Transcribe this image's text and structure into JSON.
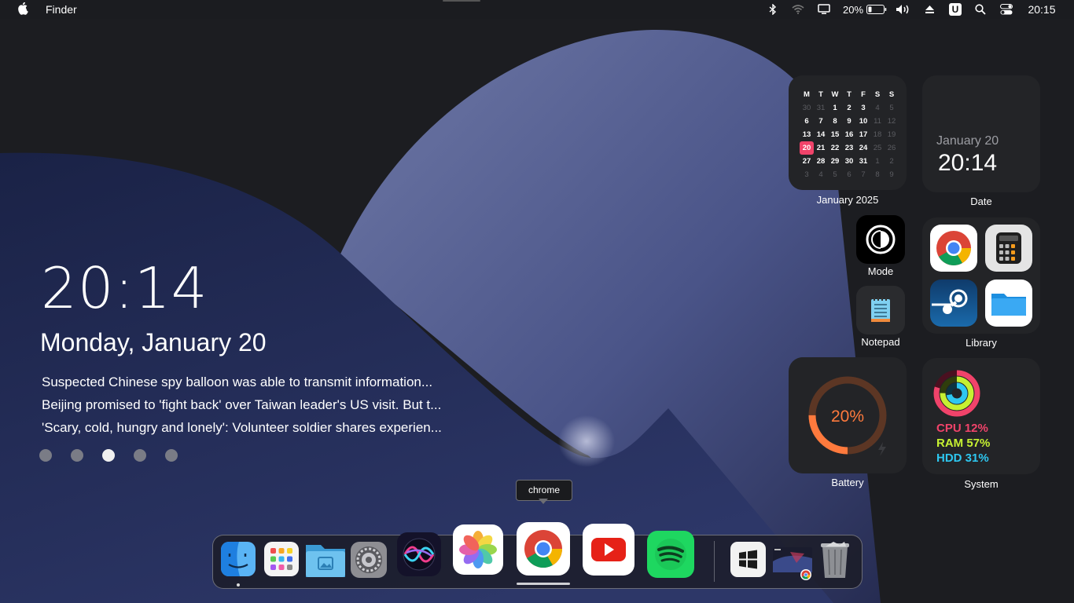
{
  "menubar": {
    "app_name": "Finder",
    "battery_text": "20%",
    "clock": "20:15",
    "u_badge": "U"
  },
  "lock": {
    "time": "20:14",
    "date": "Monday, January 20",
    "news": [
      "Suspected Chinese spy balloon was able to transmit information...",
      "Beijing promised to 'fight back' over Taiwan leader's US visit. But t...",
      "'Scary, cold, hungry and lonely': Volunteer soldier shares experien..."
    ],
    "page_count": 5,
    "active_page": 3
  },
  "widgets": {
    "calendar": {
      "label": "January 2025",
      "headers": [
        "M",
        "T",
        "W",
        "T",
        "F",
        "S",
        "S"
      ],
      "weeks": [
        [
          "30",
          "31",
          "1",
          "2",
          "3",
          "4",
          "5"
        ],
        [
          "6",
          "7",
          "8",
          "9",
          "10",
          "11",
          "12"
        ],
        [
          "13",
          "14",
          "15",
          "16",
          "17",
          "18",
          "19"
        ],
        [
          "20",
          "21",
          "22",
          "23",
          "24",
          "25",
          "26"
        ],
        [
          "27",
          "28",
          "29",
          "30",
          "31",
          "1",
          "2"
        ],
        [
          "3",
          "4",
          "5",
          "6",
          "7",
          "8",
          "9"
        ]
      ],
      "today": "20"
    },
    "date": {
      "label": "Date",
      "month_day": "January 20",
      "time": "20:14"
    },
    "mode": {
      "label": "Mode"
    },
    "notepad": {
      "label": "Notepad"
    },
    "library": {
      "label": "Library"
    },
    "battery": {
      "label": "Battery",
      "percent_text": "20%",
      "level": 0.2
    },
    "system": {
      "label": "System",
      "cpu": "CPU 12%",
      "ram": "RAM 57%",
      "hdd": "HDD 31%"
    }
  },
  "dock": {
    "tooltip": "chrome",
    "items": [
      "finder-icon",
      "launchpad-icon",
      "files-icon",
      "settings-icon",
      "siri-icon",
      "photos-icon",
      "chrome-icon",
      "youtube-icon",
      "spotify-icon",
      "windows-icon",
      "screen-preview-icon",
      "trash-icon"
    ]
  },
  "colors": {
    "today_highlight": "#f0436a",
    "battery_accent": "#ff7a3d",
    "cpu": "#f0436a",
    "ram": "#c6f032",
    "hdd": "#2ec7f0"
  }
}
